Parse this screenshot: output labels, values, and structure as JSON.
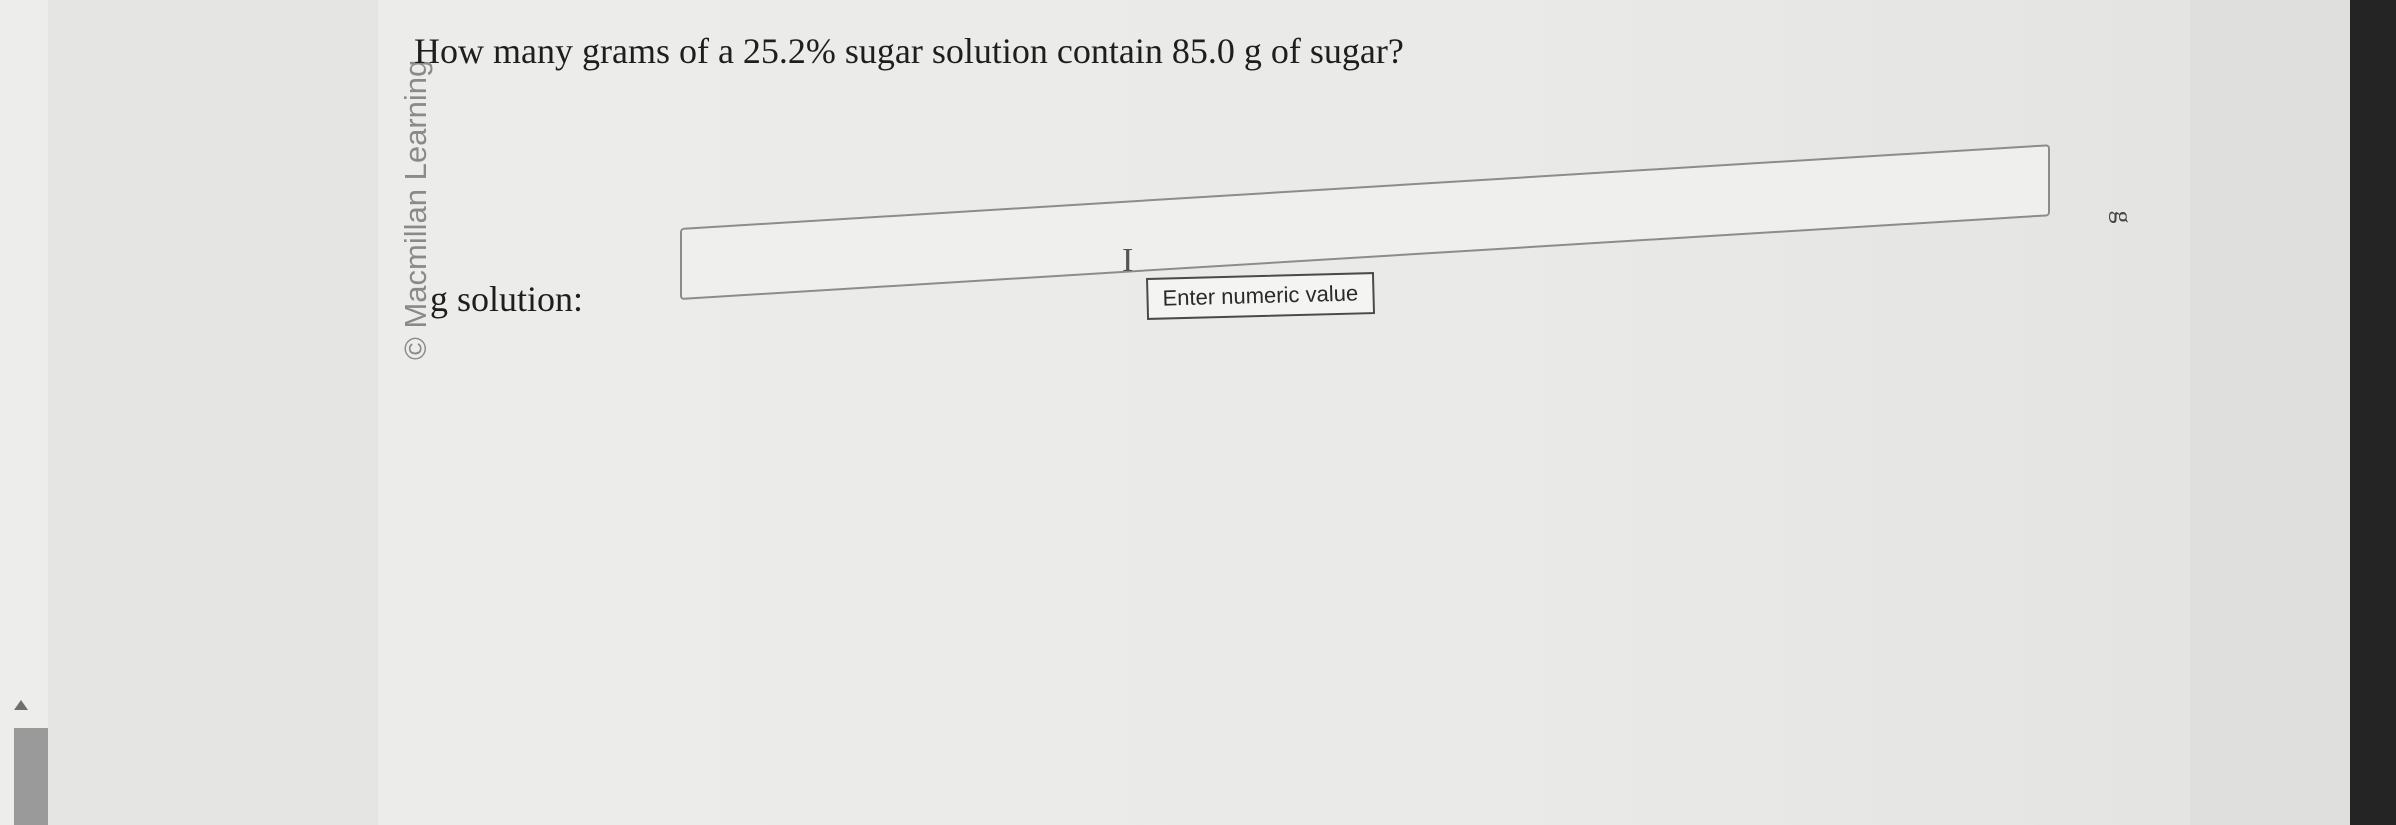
{
  "watermark": {
    "text": "© Macmillan Learning"
  },
  "question": {
    "text": "How many grams of a 25.2% sugar solution contain 85.0 g of sugar?"
  },
  "answer": {
    "label": "g solution:",
    "value": "",
    "tooltip": "Enter numeric value",
    "unit": "g",
    "cursor_icon": "text-cursor-icon"
  },
  "colors": {
    "text": "#1e1e1e",
    "watermark": "#8a8a8a",
    "field_border": "#8c8c8c"
  }
}
